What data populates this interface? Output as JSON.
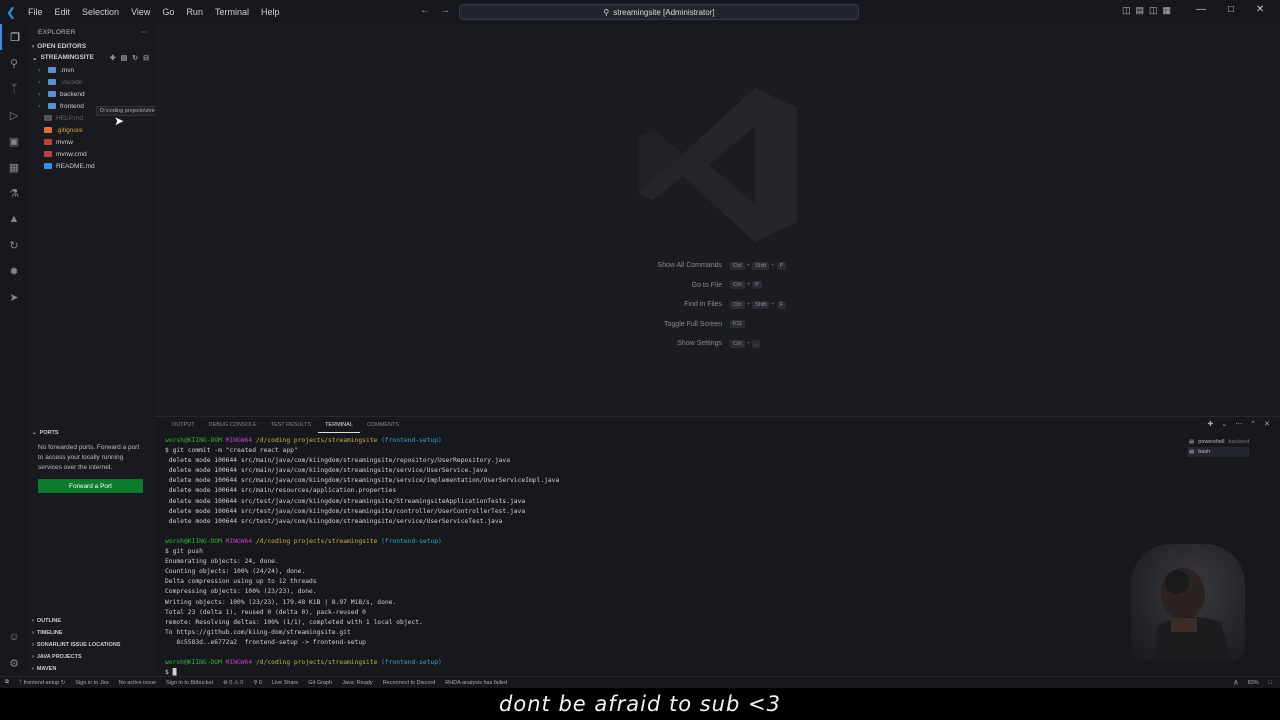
{
  "titlebar": {
    "menu": [
      "File",
      "Edit",
      "Selection",
      "View",
      "Go",
      "Run",
      "Terminal",
      "Help"
    ],
    "search_text": "streamingsite [Administrator]"
  },
  "sidebar": {
    "header": "EXPLORER",
    "open_editors": "OPEN EDITORS",
    "project": "STREAMINGSITE",
    "tree": [
      {
        "label": ".mvn",
        "type": "folder",
        "dim": false
      },
      {
        "label": ".vscode",
        "type": "folder",
        "dim": true
      },
      {
        "label": "backend",
        "type": "folder",
        "dim": false
      },
      {
        "label": "frontend",
        "type": "folder",
        "dim": false
      },
      {
        "label": "HELP.md",
        "type": "file",
        "dim": true
      },
      {
        "label": ".gitignore",
        "type": "file",
        "dim": false
      },
      {
        "label": "mvnw",
        "type": "file",
        "dim": false
      },
      {
        "label": "mvnw.cmd",
        "type": "file",
        "dim": false
      },
      {
        "label": "README.md",
        "type": "file",
        "dim": false
      }
    ],
    "tooltip": "D:\\coding projects\\streamingsite\\backend",
    "ports_header": "PORTS",
    "ports_msg": "No forwarded ports. Forward a port to access your locally running services over the internet.",
    "forward_button": "Forward a Port",
    "bottom_sections": [
      "OUTLINE",
      "TIMELINE",
      "SONARLINT ISSUE LOCATIONS",
      "JAVA PROJECTS",
      "MAVEN"
    ]
  },
  "editor": {
    "shortcuts": [
      {
        "label": "Show All Commands",
        "keys": [
          "Ctrl",
          "Shift",
          "P"
        ]
      },
      {
        "label": "Go to File",
        "keys": [
          "Ctrl",
          "P"
        ]
      },
      {
        "label": "Find in Files",
        "keys": [
          "Ctrl",
          "Shift",
          "F"
        ]
      },
      {
        "label": "Toggle Full Screen",
        "keys": [
          "F11"
        ]
      },
      {
        "label": "Show Settings",
        "keys": [
          "Ctrl",
          ","
        ]
      }
    ]
  },
  "panel": {
    "tabs": [
      "OUTPUT",
      "DEBUG CONSOLE",
      "TEST RESULTS",
      "TERMINAL",
      "COMMENTS"
    ],
    "active_tab": "TERMINAL",
    "terminals": [
      {
        "name": "powershell",
        "sub": "backend"
      },
      {
        "name": "bash",
        "sub": ""
      }
    ]
  },
  "terminal": {
    "prompt_user": "worsh@KIING-DOM",
    "prompt_host": "MINGW64",
    "prompt_path": "/d/coding projects/streamingsite",
    "prompt_branch": "(frontend-setup)",
    "cmd1": "$ git commit -m \"created react app\"",
    "deletes": [
      " delete mode 100644 src/main/java/com/kiingdom/streamingsite/repository/UserRepository.java",
      " delete mode 100644 src/main/java/com/kiingdom/streamingsite/service/UserService.java",
      " delete mode 100644 src/main/java/com/kiingdom/streamingsite/service/implementation/UserServiceImpl.java",
      " delete mode 100644 src/main/resources/application.properties",
      " delete mode 100644 src/test/java/com/kiingdom/streamingsite/StreamingsiteApplicationTests.java",
      " delete mode 100644 src/test/java/com/kiingdom/streamingsite/controller/UserControllerTest.java",
      " delete mode 100644 src/test/java/com/kiingdom/streamingsite/service/UserServiceTest.java"
    ],
    "cmd2": "$ git push",
    "push_output": [
      "Enumerating objects: 24, done.",
      "Counting objects: 100% (24/24), done.",
      "Delta compression using up to 12 threads",
      "Compressing objects: 100% (23/23), done.",
      "Writing objects: 100% (23/23), 179.48 KiB | 8.97 MiB/s, done.",
      "Total 23 (delta 1), reused 0 (delta 0), pack-reused 0",
      "remote: Resolving deltas: 100% (1/1), completed with 1 local object.",
      "To https://github.com/kiing-dom/streamingsite.git",
      "   8c5583d..e6772a2  frontend-setup -> frontend-setup"
    ],
    "cmd3": "$ "
  },
  "statusbar": {
    "branch": "frontend-setup",
    "jira": "Sign in to Jira",
    "issue": "No active issue",
    "bitbucket": "Sign in to Bitbucket",
    "problems": "0 ⚠ 0",
    "ports": "0",
    "liveshare": "Live Share",
    "gitgraph": "Git Graph",
    "java": "Java: Ready",
    "discord": "Reconnect to Discord",
    "rhda": "RHDA analysis has failed",
    "right_items": [
      "A̲",
      "83%"
    ]
  },
  "caption": "dont be afraid to sub <3",
  "colors": {
    "accent": "#3b8eea",
    "forward_button": "#0e7a2e",
    "prompt_user": "#2fb52f",
    "prompt_host": "#c341c3",
    "prompt_path": "#c9b233",
    "prompt_branch": "#2fa8c8"
  }
}
